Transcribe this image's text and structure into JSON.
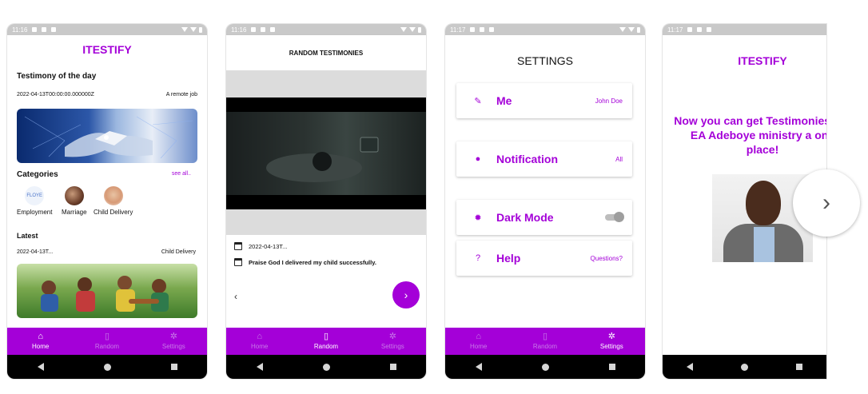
{
  "colors": {
    "accent": "#a400d8",
    "navbar": "#000000",
    "statusbar": "#c9c9c9"
  },
  "status_times": [
    "11:16",
    "11:16",
    "11:17",
    "11:17"
  ],
  "bottom_nav": [
    {
      "label": "Home",
      "icon": "home-icon"
    },
    {
      "label": "Random",
      "icon": "phone-random-icon"
    },
    {
      "label": "Settings",
      "icon": "gear-icon"
    }
  ],
  "home": {
    "title": "ITESTIFY",
    "testimony_heading": "Testimony of the day",
    "testimony_date": "2022-04-13T00:00:00.000000Z",
    "testimony_tag": "A remote job",
    "categories_heading": "Categories",
    "see_all": "see all..",
    "categories": [
      {
        "label": "Employment",
        "badge": "FLOYE"
      },
      {
        "label": "Marriage"
      },
      {
        "label": "Child Delivery"
      }
    ],
    "latest_heading": "Latest",
    "latest_date": "2022-04-13T...",
    "latest_tag": "Child Delivery"
  },
  "random": {
    "header": "RANDOM TESTIMONIES",
    "date": "2022-04-13T...",
    "text": "Praise God I delivered my child successfully.",
    "prev": "‹",
    "next": "›"
  },
  "settings": {
    "title": "SETTINGS",
    "items": [
      {
        "label": "Me",
        "value": "John Doe",
        "icon": "pencil-icon"
      },
      {
        "label": "Notification",
        "value": "All",
        "icon": "bell-icon"
      },
      {
        "label": "Dark Mode",
        "value": "",
        "icon": "sun-icon"
      },
      {
        "label": "Help",
        "value": "Questions?",
        "icon": "help-icon"
      }
    ]
  },
  "intro": {
    "title": "ITESTIFY",
    "text": "Now you can get Testimonies Pst EA Adeboye ministry a one place!"
  },
  "carousel_next": "›"
}
